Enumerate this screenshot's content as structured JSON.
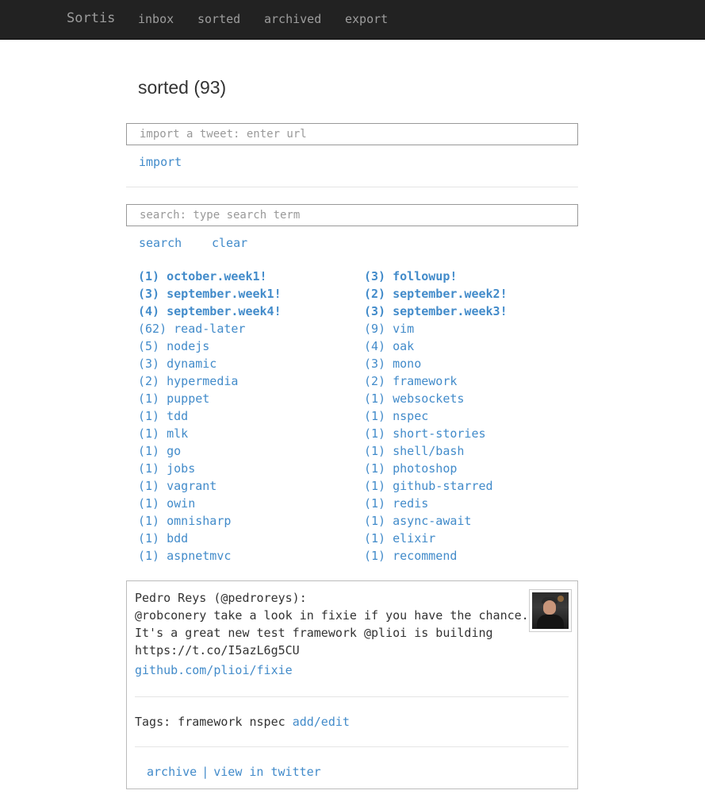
{
  "nav": {
    "brand": "Sortis",
    "links": [
      "inbox",
      "sorted",
      "archived",
      "export"
    ]
  },
  "page": {
    "title": "sorted (93)"
  },
  "import": {
    "placeholder": "import a tweet: enter url",
    "button": "import"
  },
  "search": {
    "placeholder": "search: type search term",
    "search_button": "search",
    "clear_button": "clear"
  },
  "tags": {
    "left": [
      {
        "label": "(1) october.week1!",
        "bold": true
      },
      {
        "label": "(3) september.week1!",
        "bold": true
      },
      {
        "label": "(4) september.week4!",
        "bold": true
      },
      {
        "label": "(62) read-later",
        "bold": false
      },
      {
        "label": "(5) nodejs",
        "bold": false
      },
      {
        "label": "(3) dynamic",
        "bold": false
      },
      {
        "label": "(2) hypermedia",
        "bold": false
      },
      {
        "label": "(1) puppet",
        "bold": false
      },
      {
        "label": "(1) tdd",
        "bold": false
      },
      {
        "label": "(1) mlk",
        "bold": false
      },
      {
        "label": "(1) go",
        "bold": false
      },
      {
        "label": "(1) jobs",
        "bold": false
      },
      {
        "label": "(1) vagrant",
        "bold": false
      },
      {
        "label": "(1) owin",
        "bold": false
      },
      {
        "label": "(1) omnisharp",
        "bold": false
      },
      {
        "label": "(1) bdd",
        "bold": false
      },
      {
        "label": "(1) aspnetmvc",
        "bold": false
      }
    ],
    "right": [
      {
        "label": "(3) followup!",
        "bold": true
      },
      {
        "label": "(2) september.week2!",
        "bold": true
      },
      {
        "label": "(3) september.week3!",
        "bold": true
      },
      {
        "label": "(9) vim",
        "bold": false
      },
      {
        "label": "(4) oak",
        "bold": false
      },
      {
        "label": "(3) mono",
        "bold": false
      },
      {
        "label": "(2) framework",
        "bold": false
      },
      {
        "label": "(1) websockets",
        "bold": false
      },
      {
        "label": "(1) nspec",
        "bold": false
      },
      {
        "label": "(1) short-stories",
        "bold": false
      },
      {
        "label": "(1) shell/bash",
        "bold": false
      },
      {
        "label": "(1) photoshop",
        "bold": false
      },
      {
        "label": "(1) github-starred",
        "bold": false
      },
      {
        "label": "(1) redis",
        "bold": false
      },
      {
        "label": "(1) async-await",
        "bold": false
      },
      {
        "label": "(1) elixir",
        "bold": false
      },
      {
        "label": "(1) recommend",
        "bold": false
      }
    ]
  },
  "tweet": {
    "author": "Pedro Reys (@pedroreys):",
    "text_lines": [
      "@robconery take a look in fixie if you have the chance.",
      "It's a great new test framework @plioi is building",
      "https://t.co/I5azL6g5CU"
    ],
    "link": "github.com/plioi/fixie",
    "tags_label": "Tags: framework nspec",
    "add_edit": "add/edit",
    "archive": "archive",
    "separator": "|",
    "view_twitter": "view in twitter"
  },
  "colors": {
    "navbar": "#222222",
    "link": "#428bca",
    "nav_text": "#9d9d9d"
  }
}
